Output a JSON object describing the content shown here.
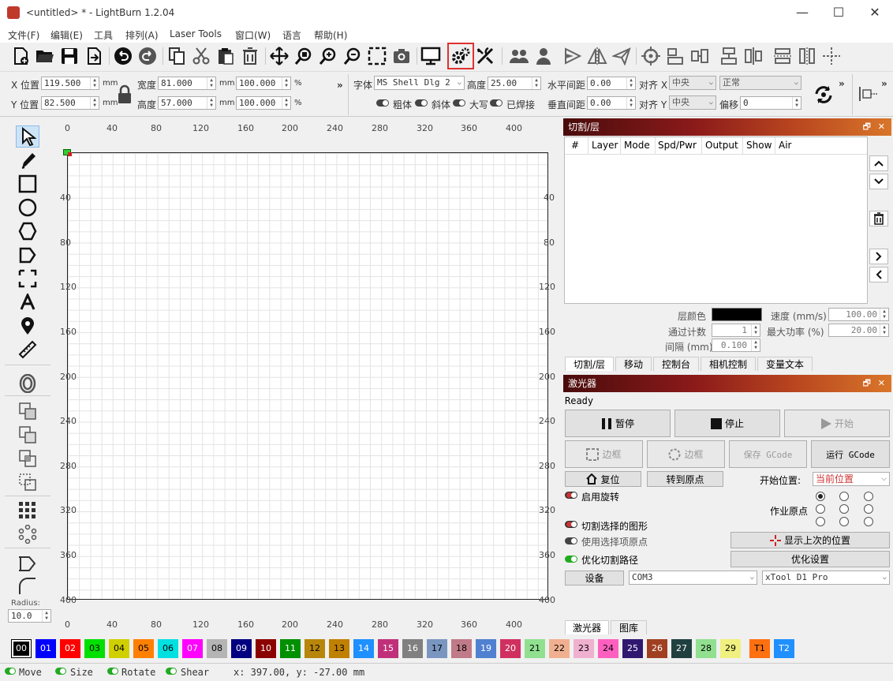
{
  "window": {
    "title": "<untitled> * - LightBurn 1.2.04",
    "minimize": "—",
    "maximize": "☐",
    "close": "✕"
  },
  "menu": [
    "文件(F)",
    "编辑(E)",
    "工具",
    "排列(A)",
    "Laser Tools",
    "窗口(W)",
    "语言",
    "帮助(H)"
  ],
  "options": {
    "x_label": "X 位置",
    "x_value": "119.500",
    "x_unit": "mm",
    "y_label": "Y 位置",
    "y_value": "82.500",
    "y_unit": "mm",
    "w_label": "宽度",
    "w_value": "81.000",
    "w_unit": "mm",
    "w_pct": "100.000",
    "w_pct_unit": "%",
    "h_label": "高度",
    "h_value": "57.000",
    "h_unit": "mm",
    "h_pct": "100.000",
    "h_pct_unit": "%",
    "more1": "»",
    "font_label": "字体",
    "font_value": "MS Shell Dlg 2",
    "height_label": "高度",
    "height_value": "25.00",
    "hspace_label": "水平间距",
    "hspace_value": "0.00",
    "align_x_label": "对齐 X",
    "align_x_value": "中央",
    "style_value": "正常",
    "vspace_label": "垂直间距",
    "vspace_value": "0.00",
    "align_y_label": "对齐 Y",
    "align_y_value": "中央",
    "offset_label": "偏移",
    "offset_value": "0",
    "bold_label": "粗体",
    "italic_label": "斜体",
    "upper_label": "大写",
    "welded_label": "已焊接",
    "more2": "»",
    "more3": "»"
  },
  "tools_radius_label": "Radius:",
  "tools_radius_value": "10.0",
  "ruler": {
    "top": [
      "0",
      "40",
      "80",
      "120",
      "160",
      "200",
      "240",
      "280",
      "320",
      "360",
      "400"
    ],
    "left": [
      "40",
      "80",
      "120",
      "160",
      "200",
      "240",
      "280",
      "320",
      "360",
      "400"
    ],
    "right": [
      "40",
      "80",
      "120",
      "160",
      "200",
      "240",
      "280",
      "320",
      "360",
      "400"
    ]
  },
  "cuts_panel": {
    "title": "切割/层",
    "columns": [
      "#",
      "Layer",
      "Mode",
      "Spd/Pwr",
      "Output",
      "Show",
      "Air"
    ],
    "layer_color_label": "层颜色",
    "speed_label": "速度 (mm/s)",
    "speed_value": "100.00",
    "passes_label": "通过计数",
    "passes_value": "1",
    "maxpower_label": "最大功率 (%)",
    "maxpower_value": "20.00",
    "interval_label": "间隔 (mm)",
    "interval_value": "0.100",
    "tabs": [
      "切割/层",
      "移动",
      "控制台",
      "相机控制",
      "变量文本"
    ]
  },
  "laser_panel": {
    "title": "激光器",
    "status": "Ready",
    "pause": "暂停",
    "stop": "停止",
    "start": "开始",
    "frame1": "边框",
    "frame2": "边框",
    "save_gcode": "保存 GCode",
    "run_gcode": "运行 GCode",
    "home": "复位",
    "goto_origin": "转到原点",
    "start_from_label": "开始位置:",
    "start_from_value": "当前位置",
    "rotary": "启用旋转",
    "job_origin_label": "作业原点",
    "cut_selected": "切割选择的图形",
    "use_selection_origin": "使用选择项原点",
    "show_last_position": "显示上次的位置",
    "optimize_path": "优化切割路径",
    "optimize_settings": "优化设置",
    "devices": "设备",
    "port_value": "COM3",
    "device_value": "xTool D1 Pro",
    "tabs": [
      "激光器",
      "图库"
    ]
  },
  "palette": [
    {
      "label": "00",
      "color": "#000000",
      "fg": "#ffffff"
    },
    {
      "label": "01",
      "color": "#0000ff",
      "fg": "#ffffff"
    },
    {
      "label": "02",
      "color": "#ff0000",
      "fg": "#ffffff"
    },
    {
      "label": "03",
      "color": "#00e000",
      "fg": "#000000"
    },
    {
      "label": "04",
      "color": "#d0d000",
      "fg": "#000000"
    },
    {
      "label": "05",
      "color": "#ff8000",
      "fg": "#000000"
    },
    {
      "label": "06",
      "color": "#00e0e0",
      "fg": "#000000"
    },
    {
      "label": "07",
      "color": "#ff00ff",
      "fg": "#ffffff"
    },
    {
      "label": "08",
      "color": "#b4b4b4",
      "fg": "#000000"
    },
    {
      "label": "09",
      "color": "#000080",
      "fg": "#ffffff"
    },
    {
      "label": "10",
      "color": "#8b0000",
      "fg": "#ffffff"
    },
    {
      "label": "11",
      "color": "#009000",
      "fg": "#ffffff"
    },
    {
      "label": "12",
      "color": "#b8860b",
      "fg": "#000000"
    },
    {
      "label": "13",
      "color": "#c08000",
      "fg": "#000000"
    },
    {
      "label": "14",
      "color": "#1e90ff",
      "fg": "#ffffff"
    },
    {
      "label": "15",
      "color": "#c0307a",
      "fg": "#ffffff"
    },
    {
      "label": "16",
      "color": "#808080",
      "fg": "#ffffff"
    },
    {
      "label": "17",
      "color": "#7a96c0",
      "fg": "#000000"
    },
    {
      "label": "18",
      "color": "#c07a88",
      "fg": "#000000"
    },
    {
      "label": "19",
      "color": "#5080d0",
      "fg": "#ffffff"
    },
    {
      "label": "20",
      "color": "#d03060",
      "fg": "#ffffff"
    },
    {
      "label": "21",
      "color": "#90e090",
      "fg": "#000000"
    },
    {
      "label": "22",
      "color": "#f0b090",
      "fg": "#000000"
    },
    {
      "label": "23",
      "color": "#f0b0d0",
      "fg": "#000000"
    },
    {
      "label": "24",
      "color": "#ff60c0",
      "fg": "#000000"
    },
    {
      "label": "25",
      "color": "#301870",
      "fg": "#ffffff"
    },
    {
      "label": "26",
      "color": "#a04020",
      "fg": "#ffffff"
    },
    {
      "label": "27",
      "color": "#204040",
      "fg": "#ffffff"
    },
    {
      "label": "28",
      "color": "#90e090",
      "fg": "#000000"
    },
    {
      "label": "29",
      "color": "#f0f080",
      "fg": "#000000"
    },
    {
      "label": "T1",
      "color": "#ff7010",
      "fg": "#000000"
    },
    {
      "label": "T2",
      "color": "#2090ff",
      "fg": "#ffffff"
    }
  ],
  "status": {
    "move": "Move",
    "size": "Size",
    "rotate": "Rotate",
    "shear": "Shear",
    "coords": "x: 397.00, y: -27.00 mm"
  },
  "colors": {
    "highlight": "#e03030"
  }
}
